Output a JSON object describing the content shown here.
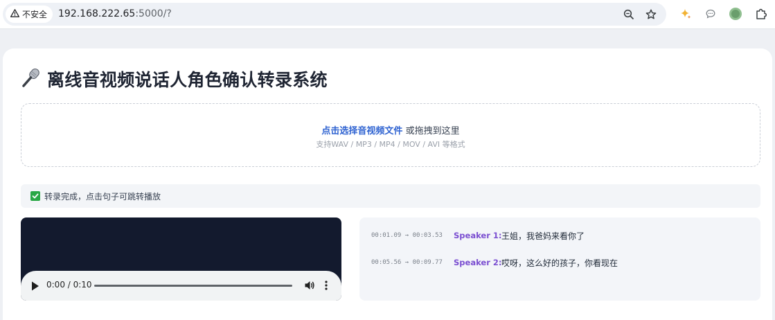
{
  "browser": {
    "security_label": "不安全",
    "url_host": "192.168.222.65",
    "url_rest": ":5000/?",
    "icons": [
      "warning-icon",
      "zoom-icon",
      "bookmark-star-icon",
      "gemini-icon",
      "chat-icon",
      "profile-icon",
      "extensions-icon"
    ]
  },
  "page": {
    "title": "离线音视频说话人角色确认转录系统",
    "title_icon": "microphone-icon"
  },
  "upload": {
    "link_text": "点击选择音视频文件",
    "drag_text": " 或拖拽到这里",
    "formats": "支持WAV / MP3 / MP4 / MOV / AVI 等格式"
  },
  "status": {
    "text": "转录完成，点击句子可跳转播放",
    "icon": "check-icon",
    "color": "#29a745"
  },
  "player": {
    "time": "0:00 / 0:10",
    "progress": 0
  },
  "transcript": {
    "segments": [
      {
        "time": "00:01.09 → 00:03.53",
        "speaker": "Speaker 1:",
        "text": "王姐，我爸妈来看你了"
      },
      {
        "time": "00:05.56 → 00:09.77",
        "speaker": "Speaker 2:",
        "text": "哎呀，这么好的孩子，你看现在"
      }
    ],
    "speaker_color": "#7b4fd1"
  }
}
